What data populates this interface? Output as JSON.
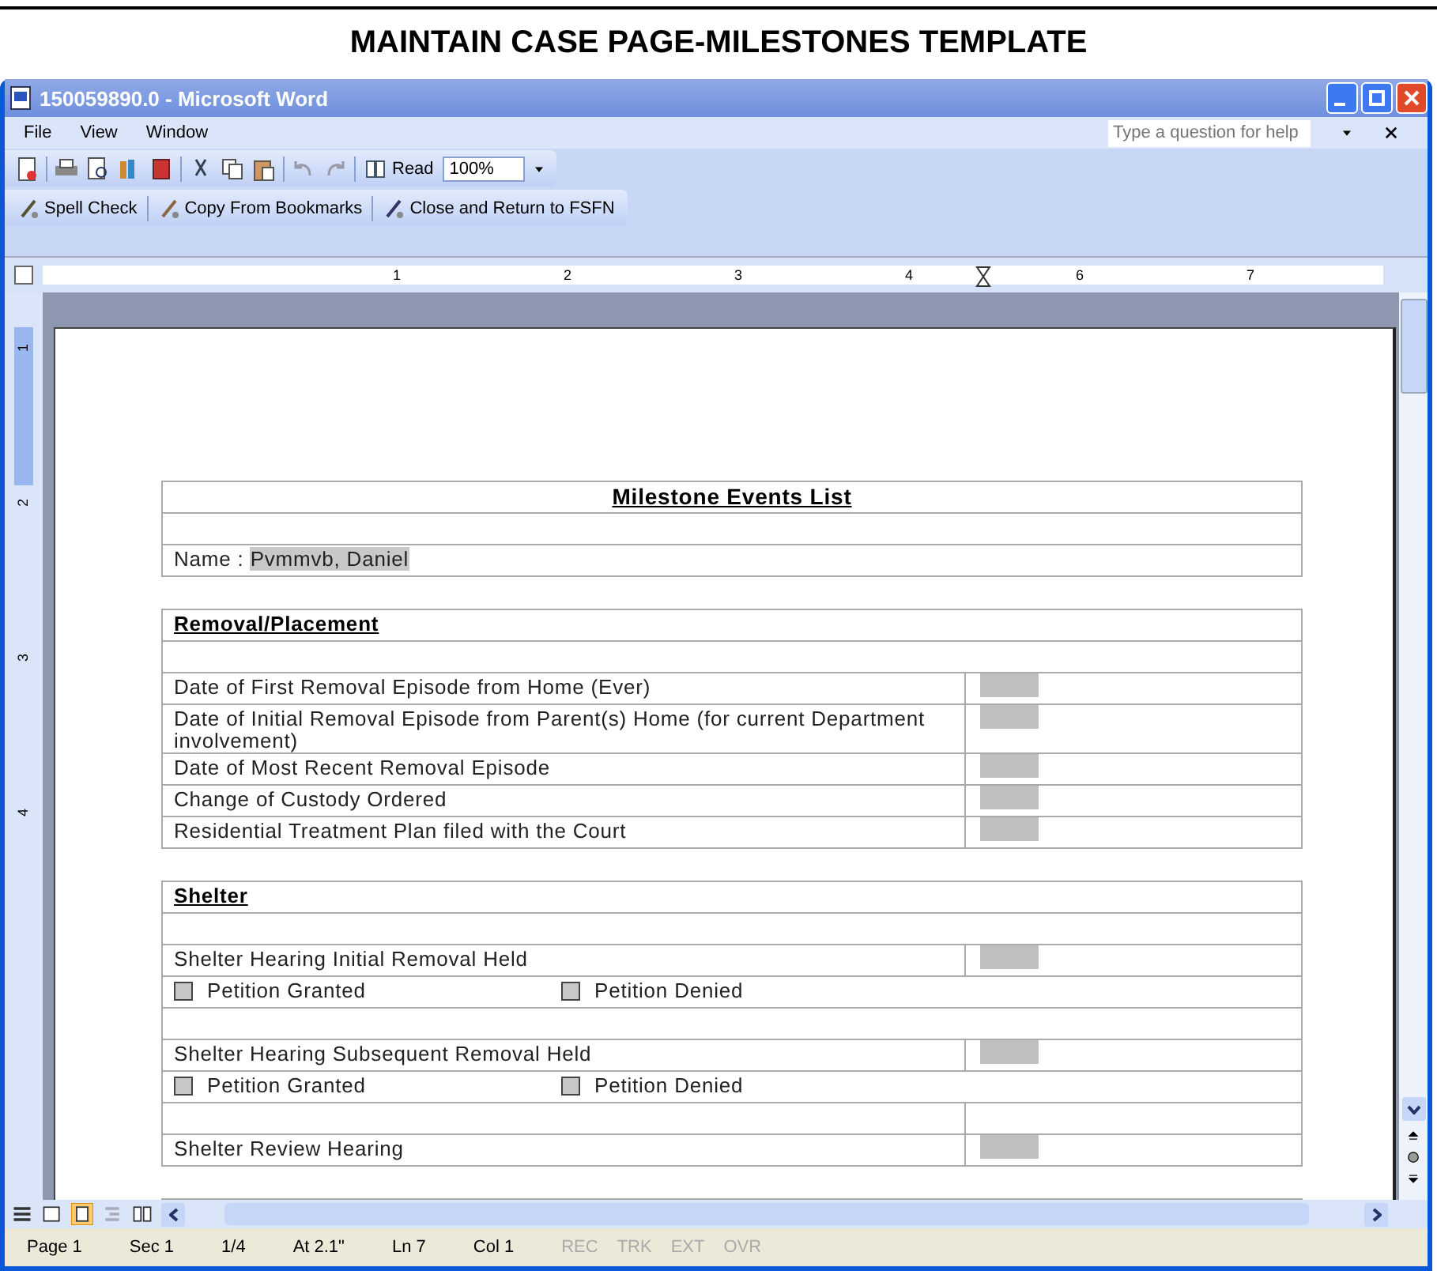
{
  "caption": "MAINTAIN CASE PAGE-MILESTONES  TEMPLATE",
  "window": {
    "title": "150059890.0 - Microsoft Word"
  },
  "menu": [
    "File",
    "View",
    "Window"
  ],
  "help": {
    "placeholder": "Type a question for help"
  },
  "toolbar": {
    "read": "Read",
    "zoom": "100%"
  },
  "toolbar2": [
    "Spell Check",
    "Copy From Bookmarks",
    "Close and Return to FSFN"
  ],
  "ruler": [
    "1",
    "2",
    "3",
    "4",
    "6",
    "7"
  ],
  "vruler": [
    "1",
    "2",
    "3",
    "4"
  ],
  "tables": [
    {
      "rows": [
        {
          "kind": "title",
          "text": "Milestone Events List"
        },
        {
          "kind": "blank"
        },
        {
          "kind": "name",
          "label": "Name : ",
          "value": "Pvmmvb, Daniel"
        }
      ]
    },
    {
      "rows": [
        {
          "kind": "heading",
          "text": "Removal/Placement"
        },
        {
          "kind": "blank"
        },
        {
          "kind": "field",
          "text": "Date of First Removal Episode from Home (Ever)"
        },
        {
          "kind": "field",
          "text": "Date of Initial Removal Episode from Parent(s) Home (for current Department involvement)"
        },
        {
          "kind": "field",
          "text": "Date of Most Recent Removal Episode"
        },
        {
          "kind": "field",
          "text": "Change of Custody Ordered"
        },
        {
          "kind": "field",
          "text": "Residential Treatment Plan filed with the Court"
        }
      ]
    },
    {
      "rows": [
        {
          "kind": "heading",
          "text": "Shelter"
        },
        {
          "kind": "blank"
        },
        {
          "kind": "field",
          "text": "Shelter Hearing Initial Removal Held"
        },
        {
          "kind": "checks",
          "items": [
            {
              "label": "Petition Granted",
              "checked": false
            },
            {
              "label": "Petition Denied",
              "checked": false
            }
          ]
        },
        {
          "kind": "blank"
        },
        {
          "kind": "field",
          "text": "Shelter Hearing Subsequent Removal Held"
        },
        {
          "kind": "checks",
          "items": [
            {
              "label": "Petition Granted",
              "checked": false
            },
            {
              "label": "Petition Denied",
              "checked": false
            }
          ]
        },
        {
          "kind": "split"
        },
        {
          "kind": "field",
          "text": "Shelter Review Hearing"
        }
      ]
    }
  ],
  "status_bar": [
    {
      "text": "Page 1",
      "disabled": false
    },
    {
      "text": "Sec 1",
      "disabled": false
    },
    {
      "text": "1/4",
      "disabled": false
    },
    {
      "text": "At 2.1\"",
      "disabled": false
    },
    {
      "text": "Ln 7",
      "disabled": false
    },
    {
      "text": "Col 1",
      "disabled": false
    },
    {
      "text": "REC",
      "disabled": true
    },
    {
      "text": "TRK",
      "disabled": true
    },
    {
      "text": "EXT",
      "disabled": true
    },
    {
      "text": "OVR",
      "disabled": true
    }
  ]
}
